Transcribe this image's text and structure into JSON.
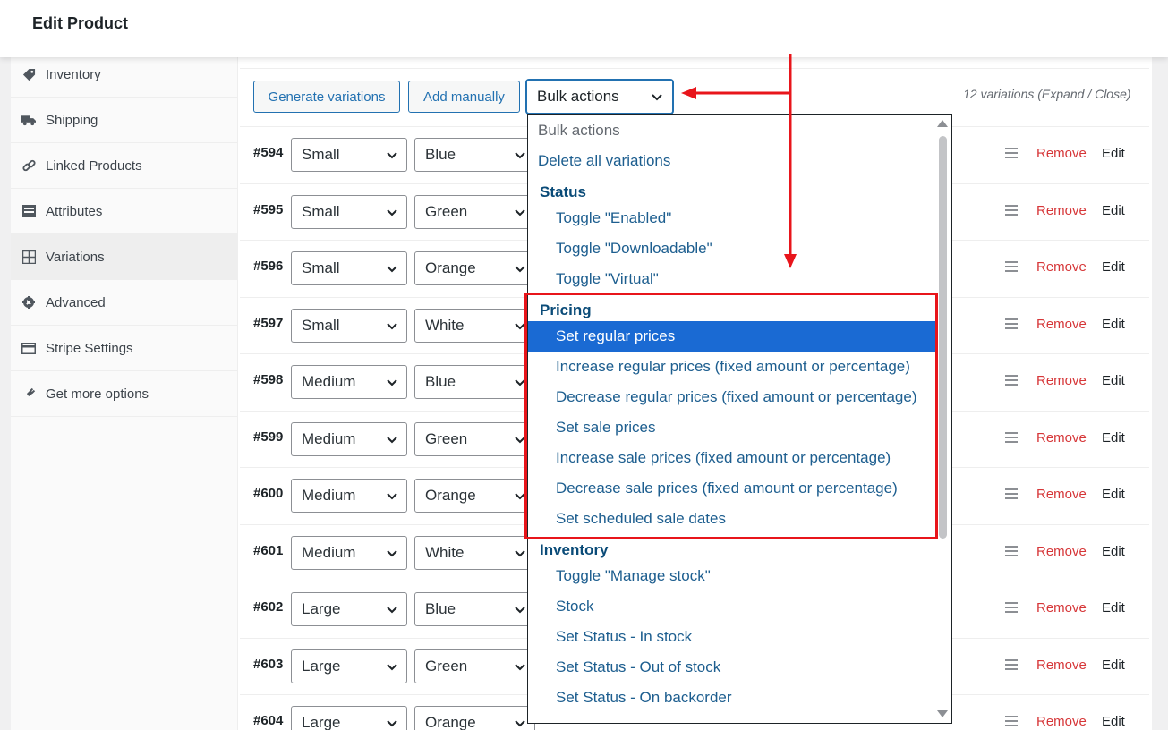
{
  "header": {
    "title": "Edit Product"
  },
  "sidebar": {
    "items": [
      {
        "label": "Inventory",
        "icon": "tag-icon"
      },
      {
        "label": "Shipping",
        "icon": "truck-icon"
      },
      {
        "label": "Linked Products",
        "icon": "link-icon"
      },
      {
        "label": "Attributes",
        "icon": "list-icon"
      },
      {
        "label": "Variations",
        "icon": "grid-icon",
        "active": true
      },
      {
        "label": "Advanced",
        "icon": "gear-icon"
      },
      {
        "label": "Stripe Settings",
        "icon": "card-icon"
      },
      {
        "label": "Get more options",
        "icon": "plugin-icon"
      }
    ]
  },
  "toolbar": {
    "generate_label": "Generate variations",
    "add_manually_label": "Add manually",
    "bulk_actions_value": "Bulk actions",
    "variation_count": "12 variations (Expand / Close)"
  },
  "variations": [
    {
      "id": "#594",
      "size": "Small",
      "color": "Blue"
    },
    {
      "id": "#595",
      "size": "Small",
      "color": "Green"
    },
    {
      "id": "#596",
      "size": "Small",
      "color": "Orange"
    },
    {
      "id": "#597",
      "size": "Small",
      "color": "White"
    },
    {
      "id": "#598",
      "size": "Medium",
      "color": "Blue"
    },
    {
      "id": "#599",
      "size": "Medium",
      "color": "Green"
    },
    {
      "id": "#600",
      "size": "Medium",
      "color": "Orange"
    },
    {
      "id": "#601",
      "size": "Medium",
      "color": "White"
    },
    {
      "id": "#602",
      "size": "Large",
      "color": "Blue"
    },
    {
      "id": "#603",
      "size": "Large",
      "color": "Green"
    },
    {
      "id": "#604",
      "size": "Large",
      "color": "Orange"
    }
  ],
  "row_actions": {
    "remove": "Remove",
    "edit": "Edit"
  },
  "dropdown": {
    "placeholder": "Bulk actions",
    "delete_all": "Delete all variations",
    "groups": {
      "status": "Status",
      "pricing": "Pricing",
      "inventory": "Inventory"
    },
    "status_items": [
      "Toggle \"Enabled\"",
      "Toggle \"Downloadable\"",
      "Toggle \"Virtual\""
    ],
    "pricing_items": [
      "Set regular prices",
      "Increase regular prices (fixed amount or percentage)",
      "Decrease regular prices (fixed amount or percentage)",
      "Set sale prices",
      "Increase sale prices (fixed amount or percentage)",
      "Decrease sale prices (fixed amount or percentage)",
      "Set scheduled sale dates"
    ],
    "inventory_items": [
      "Toggle \"Manage stock\"",
      "Stock",
      "Set Status - In stock",
      "Set Status - Out of stock",
      "Set Status - On backorder"
    ],
    "selected": "Set regular prices"
  },
  "colors": {
    "accent": "#2271b1",
    "remove": "#d63638",
    "selected_bg": "#1a6ad3",
    "annotation": "#e8151b",
    "group_heading": "#0a4b78"
  }
}
